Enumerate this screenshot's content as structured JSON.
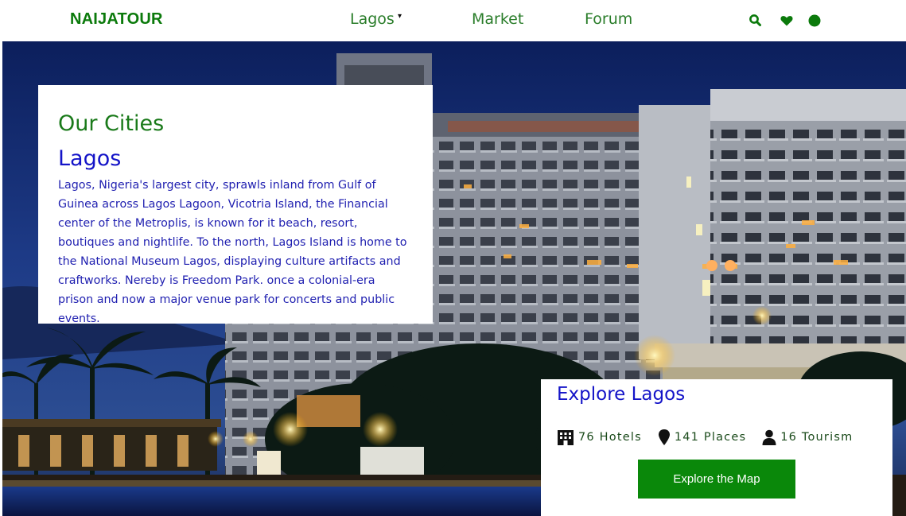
{
  "nav": {
    "brand": "NAIJATOUR",
    "links": [
      "Lagos",
      "Market",
      "Forum"
    ],
    "caret": "▾",
    "icons": [
      "search-icon",
      "heart-icon",
      "user-icon"
    ]
  },
  "colors": {
    "brand_green": "#0b7a0b",
    "nav_green": "#2a7d2a",
    "heading_green": "#1a7a1a",
    "text_blue": "#1414c8",
    "button_green": "#0a880a"
  },
  "card": {
    "heading": "Our Cities",
    "city": "Lagos",
    "description": "Lagos, Nigeria's largest city, sprawls inland from Gulf of Guinea across Lagos Lagoon, Vicotria Island, the Financial center of the Metroplis, is known for it beach, resort, boutiques and nightlife. To the north, Lagos Island is home to the National Museum Lagos, displaying culture artifacts and craftworks. Nereby is Freedom Park. once a colonial-era prison and now a major venue park for concerts and public events."
  },
  "explore": {
    "title": "Explore Lagos",
    "stats": [
      {
        "icon": "hotel-icon",
        "text": "76 Hotels"
      },
      {
        "icon": "map-marker-icon",
        "text": "141 Places"
      },
      {
        "icon": "user-icon",
        "text": "16 Tourism"
      }
    ],
    "button": "Explore the Map"
  }
}
